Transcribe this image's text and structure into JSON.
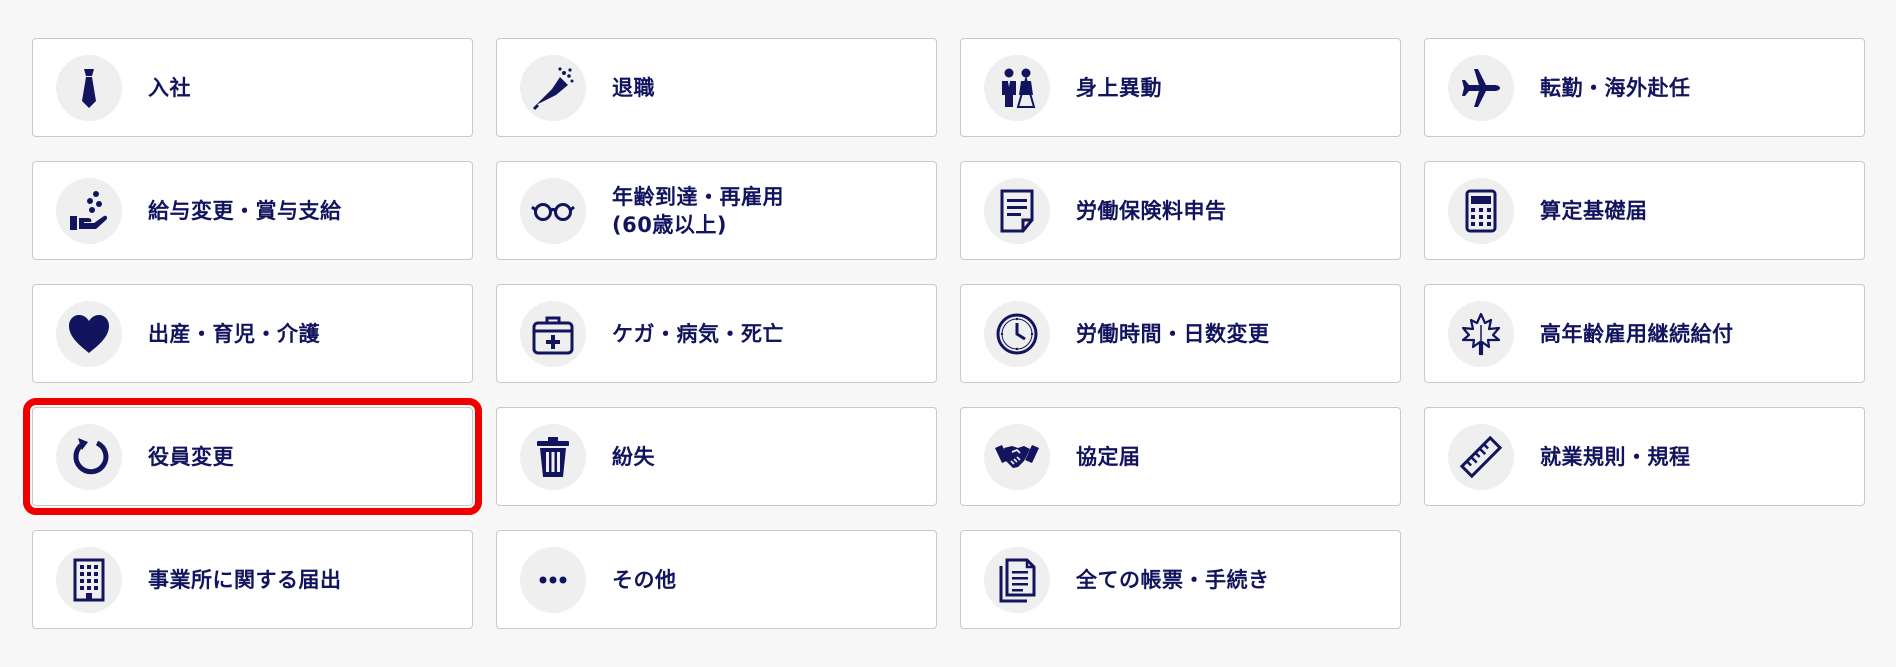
{
  "colors": {
    "background": "#f7f7f7",
    "card_border": "#c9c9c9",
    "text": "#12155e",
    "icon": "#12155e",
    "icon_bg": "#efefef",
    "highlight": "#ee0000"
  },
  "cards": [
    {
      "label": "入社",
      "icon": "necktie-icon"
    },
    {
      "label": "退職",
      "icon": "bouquet-icon"
    },
    {
      "label": "身上異動",
      "icon": "wedding-couple-icon"
    },
    {
      "label": "転勤・海外赴任",
      "icon": "airplane-icon"
    },
    {
      "label": "給与変更・賞与支給",
      "icon": "hand-coins-icon"
    },
    {
      "label": "年齢到達・再雇用\n(60歳以上)",
      "icon": "glasses-icon"
    },
    {
      "label": "労働保険料申告",
      "icon": "document-icon"
    },
    {
      "label": "算定基礎届",
      "icon": "calculator-icon"
    },
    {
      "label": "出産・育児・介護",
      "icon": "heart-icon"
    },
    {
      "label": "ケガ・病気・死亡",
      "icon": "first-aid-kit-icon"
    },
    {
      "label": "労働時間・日数変更",
      "icon": "clock-icon"
    },
    {
      "label": "高年齢雇用継続給付",
      "icon": "maple-leaf-icon"
    },
    {
      "label": "役員変更",
      "icon": "refresh-icon",
      "highlighted": true
    },
    {
      "label": "紛失",
      "icon": "trash-icon"
    },
    {
      "label": "協定届",
      "icon": "handshake-icon"
    },
    {
      "label": "就業規則・規程",
      "icon": "ruler-icon"
    },
    {
      "label": "事業所に関する届出",
      "icon": "building-icon"
    },
    {
      "label": "その他",
      "icon": "ellipsis-icon"
    },
    {
      "label": "全ての帳票・手続き",
      "icon": "documents-icon"
    }
  ]
}
